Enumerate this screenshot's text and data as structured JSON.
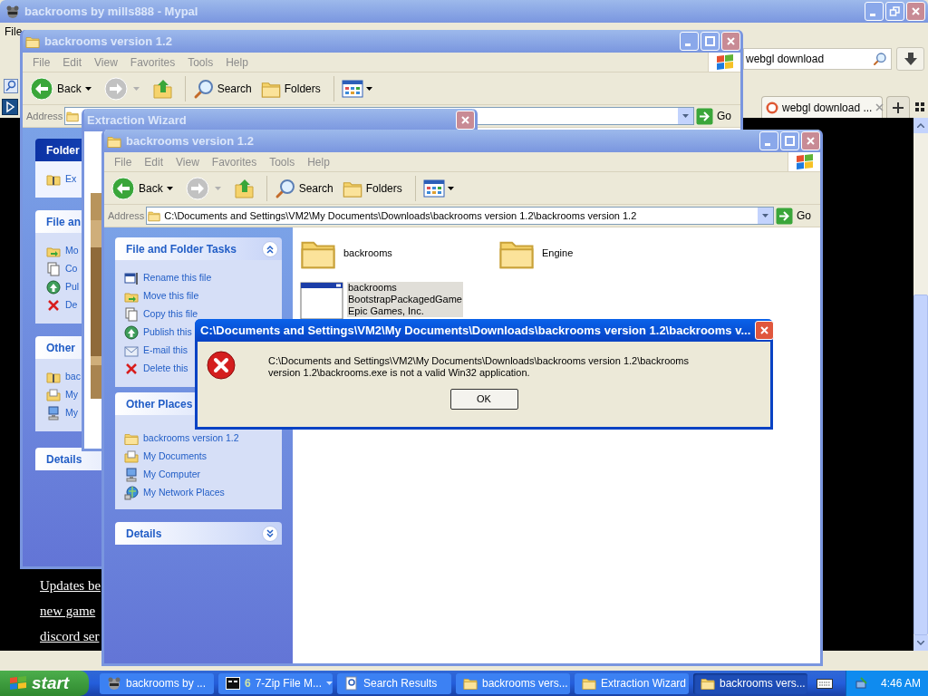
{
  "browser": {
    "title": "backrooms by mills888 - Mypal",
    "active": false,
    "menu": [
      "File"
    ],
    "search": {
      "value": "webgl download"
    },
    "tabs": [
      {
        "label": "webgl download ...",
        "selected": true
      }
    ],
    "links": [
      "Updates be",
      "new game",
      "discord ser"
    ]
  },
  "back_window": {
    "title": "backrooms version 1.2",
    "active": false,
    "menu": [
      "File",
      "Edit",
      "View",
      "Favorites",
      "Tools",
      "Help"
    ],
    "toolbar": {
      "back": "Back",
      "search": "Search",
      "folders": "Folders"
    },
    "address_label": "Address",
    "go": "Go",
    "task_panels": [
      {
        "title": "Folder",
        "kind": "special",
        "items": [
          "Ex"
        ]
      },
      {
        "title": "File an",
        "kind": "normal",
        "items": [
          "Mo",
          "Co",
          "Pul",
          "De"
        ]
      },
      {
        "title": "Other",
        "kind": "normal",
        "items": [
          "bac",
          "My",
          "My"
        ]
      },
      {
        "title": "Details",
        "kind": "normal"
      }
    ]
  },
  "wizard": {
    "title": "Extraction Wizard",
    "active": false
  },
  "front_window": {
    "title": "backrooms version 1.2",
    "active": false,
    "menu": [
      "File",
      "Edit",
      "View",
      "Favorites",
      "Tools",
      "Help"
    ],
    "toolbar": {
      "back": "Back",
      "search": "Search",
      "folders": "Folders"
    },
    "address_label": "Address",
    "address": "C:\\Documents and Settings\\VM2\\My Documents\\Downloads\\backrooms version 1.2\\backrooms version 1.2",
    "go": "Go",
    "task_panels": [
      {
        "title": "File and Folder Tasks",
        "kind": "normal",
        "expanded": true,
        "items": [
          "Rename this file",
          "Move this file",
          "Copy this file",
          "Publish this",
          "E-mail this",
          "Delete this"
        ]
      },
      {
        "title": "Other Places",
        "kind": "normal",
        "items": [
          "backrooms version 1.2",
          "My Documents",
          "My Computer",
          "My Network Places"
        ]
      },
      {
        "title": "Details",
        "kind": "normal",
        "expanded": false
      }
    ],
    "files": [
      {
        "kind": "folder",
        "lines": [
          "backrooms"
        ],
        "selected": false
      },
      {
        "kind": "folder",
        "lines": [
          "Engine"
        ],
        "selected": false
      },
      {
        "kind": "app",
        "lines": [
          "backrooms",
          "BootstrapPackagedGame",
          "Epic Games, Inc."
        ],
        "selected": true
      }
    ]
  },
  "dialog": {
    "title": "C:\\Documents and Settings\\VM2\\My Documents\\Downloads\\backrooms version 1.2\\backrooms v...",
    "active": true,
    "message": "C:\\Documents and Settings\\VM2\\My Documents\\Downloads\\backrooms version 1.2\\backrooms version 1.2\\backrooms.exe is not a valid Win32 application.",
    "button": "OK"
  },
  "taskbar": {
    "start": "start",
    "tasks": [
      {
        "kind": "browser",
        "label": "backrooms by ...",
        "selected": false
      },
      {
        "kind": "group",
        "count": "6",
        "label": "7-Zip File M...",
        "selected": false
      },
      {
        "kind": "search",
        "label": "Search Results",
        "selected": false
      },
      {
        "kind": "folder",
        "label": "backrooms vers...",
        "selected": false
      },
      {
        "kind": "folder",
        "label": "Extraction Wizard",
        "selected": false
      },
      {
        "kind": "folder",
        "label": "backrooms vers...",
        "selected": true
      }
    ],
    "clock": "4:46 AM"
  }
}
